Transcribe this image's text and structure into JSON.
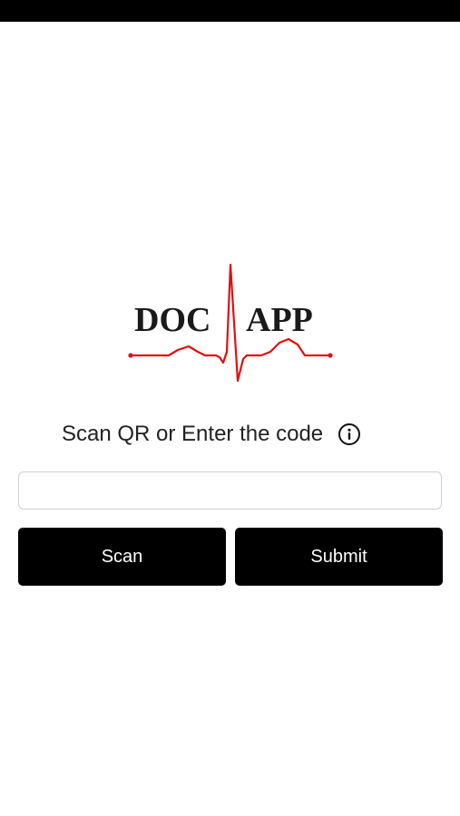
{
  "logo": {
    "left_text": "DOC",
    "right_text": "APP",
    "pulse_color": "#e01010",
    "text_color": "#1a1a1a"
  },
  "prompt": {
    "text": "Scan QR or Enter the code",
    "info_icon": "info-circle-icon"
  },
  "code_input": {
    "value": "",
    "placeholder": ""
  },
  "buttons": {
    "scan_label": "Scan",
    "submit_label": "Submit"
  },
  "colors": {
    "button_bg": "#000000",
    "button_text": "#ffffff",
    "status_bar": "#000000"
  }
}
